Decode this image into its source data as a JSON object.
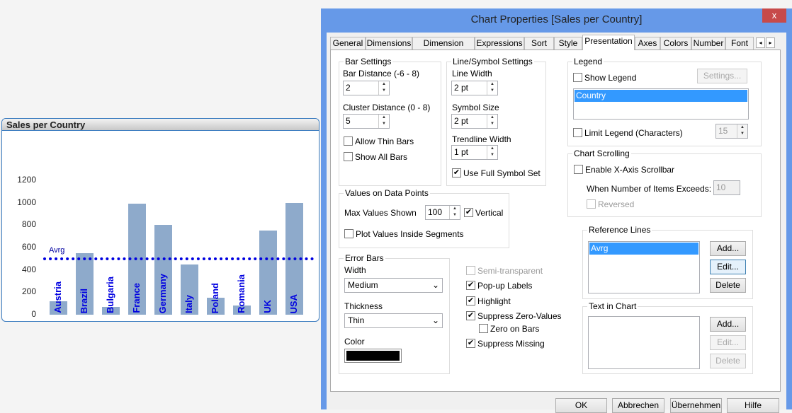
{
  "chart": {
    "title": "Sales per Country",
    "reference_line_label": "Avrg",
    "chart_data": {
      "type": "bar",
      "title": "Sales per Country",
      "categories": [
        "Austria",
        "Brazil",
        "Bulgaria",
        "France",
        "Germany",
        "Italy",
        "Poland",
        "Romania",
        "UK",
        "USA"
      ],
      "values": [
        120,
        550,
        70,
        990,
        800,
        450,
        150,
        80,
        750,
        1000
      ],
      "ylim": [
        0,
        1200
      ],
      "yticks": [
        "0",
        "200",
        "400",
        "600",
        "800",
        "1000",
        "1200"
      ],
      "reference_lines": [
        {
          "label": "Avrg",
          "value": 500,
          "color": "#0000e0",
          "style": "dotted"
        }
      ],
      "bar_color": "#8eaacb",
      "label_color": "#0000e0",
      "legend": "none",
      "grid": false
    }
  },
  "dialog": {
    "title": "Chart Properties [Sales per Country]",
    "close": "x",
    "tabs": [
      "General",
      "Dimensions",
      "Dimension Limits",
      "Expressions",
      "Sort",
      "Style",
      "Presentation",
      "Axes",
      "Colors",
      "Number",
      "Font"
    ],
    "active_tab": "Presentation",
    "tab_scroll": [
      "◂",
      "▸"
    ],
    "bar_settings": {
      "title": "Bar Settings",
      "bar_distance_label": "Bar Distance (-6 - 8)",
      "bar_distance": "2",
      "cluster_distance_label": "Cluster Distance (0 - 8)",
      "cluster_distance": "5",
      "allow_thin_bars": "Allow Thin Bars",
      "show_all_bars": "Show All Bars"
    },
    "line_symbol": {
      "title": "Line/Symbol Settings",
      "line_width_label": "Line Width",
      "line_width": "2 pt",
      "symbol_size_label": "Symbol Size",
      "symbol_size": "2 pt",
      "trendline_width_label": "Trendline Width",
      "trendline_width": "1 pt",
      "full_symbol_set": "Use Full Symbol Set"
    },
    "values_on_points": {
      "title": "Values on Data Points",
      "max_values_label": "Max Values Shown",
      "max_values": "100",
      "vertical": "Vertical",
      "plot_inside": "Plot Values Inside Segments"
    },
    "error_bars": {
      "title": "Error Bars",
      "width_label": "Width",
      "width": "Medium",
      "thickness_label": "Thickness",
      "thickness": "Thin",
      "color_label": "Color",
      "color": "#000000"
    },
    "options": {
      "semi_transparent": "Semi-transparent",
      "popup_labels": "Pop-up Labels",
      "highlight": "Highlight",
      "suppress_zero": "Suppress Zero-Values",
      "zero_on_bars": "Zero on Bars",
      "suppress_missing": "Suppress Missing"
    },
    "legend": {
      "title": "Legend",
      "show_legend": "Show Legend",
      "settings": "Settings...",
      "items": [
        "Country"
      ],
      "limit_legend": "Limit Legend (Characters)",
      "limit_value": "15"
    },
    "scrolling": {
      "title": "Chart Scrolling",
      "enable": "Enable X-Axis Scrollbar",
      "exceeds_label": "When Number of Items Exceeds:",
      "exceeds_value": "10",
      "reversed": "Reversed"
    },
    "reference_lines": {
      "title": "Reference Lines",
      "items": [
        "Avrg"
      ],
      "add": "Add...",
      "edit": "Edit...",
      "delete": "Delete"
    },
    "text_in_chart": {
      "title": "Text in Chart",
      "add": "Add...",
      "edit": "Edit...",
      "delete": "Delete"
    },
    "footer": {
      "ok": "OK",
      "cancel": "Abbrechen",
      "apply": "Übernehmen",
      "help": "Hilfe"
    }
  }
}
